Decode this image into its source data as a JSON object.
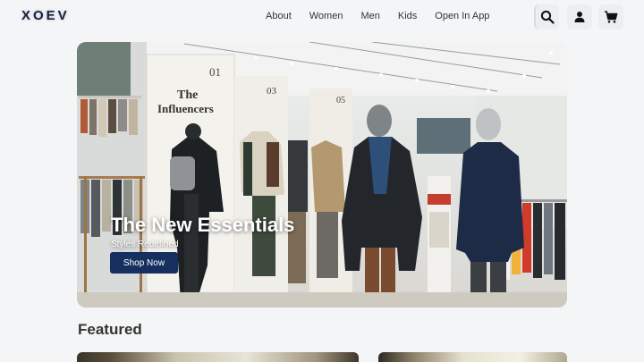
{
  "brand": {
    "logo_text": "XOEV"
  },
  "nav": {
    "items": [
      "About",
      "Women",
      "Men",
      "Kids",
      "Open In App"
    ]
  },
  "header_icons": [
    "search-icon",
    "user-icon",
    "cart-icon"
  ],
  "hero": {
    "store_sign_number": "01",
    "store_sign_title": "The Influencers",
    "panel_numbers": [
      "03",
      "05"
    ],
    "title": "The New Essentials",
    "subtitle": "Styles Redefined",
    "cta_label": "Shop Now"
  },
  "featured": {
    "title": "Featured"
  },
  "colors": {
    "page_bg": "#f4f5f7",
    "cta_bg": "#15305f",
    "text_dark": "#222222"
  }
}
